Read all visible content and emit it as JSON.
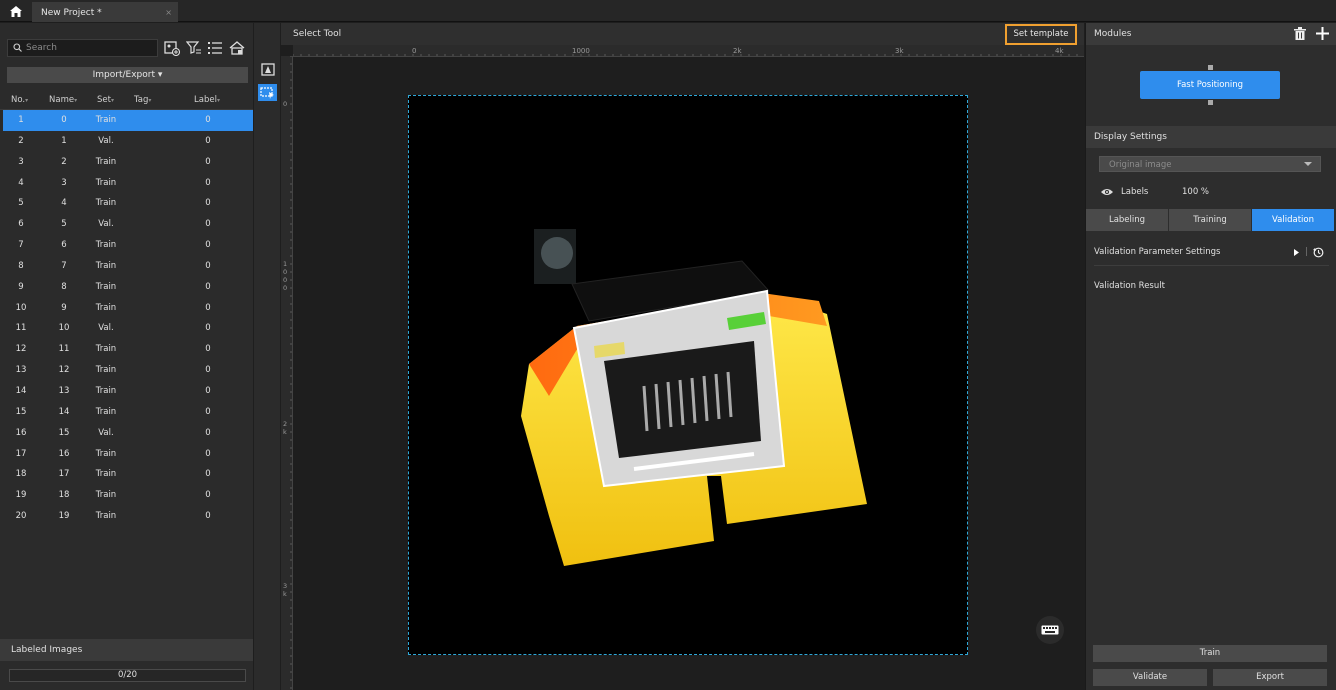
{
  "titlebar": {
    "tab_title": "New Project *",
    "tab_close": "×"
  },
  "left_panel": {
    "search_placeholder": "Search",
    "import_export": "Import/Export",
    "columns": [
      "No.",
      "Name",
      "Set",
      "Tag",
      "Label"
    ],
    "rows": [
      {
        "no": "1",
        "name": "0",
        "set": "Train",
        "label": "0"
      },
      {
        "no": "2",
        "name": "1",
        "set": "Val.",
        "label": "0"
      },
      {
        "no": "3",
        "name": "2",
        "set": "Train",
        "label": "0"
      },
      {
        "no": "4",
        "name": "3",
        "set": "Train",
        "label": "0"
      },
      {
        "no": "5",
        "name": "4",
        "set": "Train",
        "label": "0"
      },
      {
        "no": "6",
        "name": "5",
        "set": "Val.",
        "label": "0"
      },
      {
        "no": "7",
        "name": "6",
        "set": "Train",
        "label": "0"
      },
      {
        "no": "8",
        "name": "7",
        "set": "Train",
        "label": "0"
      },
      {
        "no": "9",
        "name": "8",
        "set": "Train",
        "label": "0"
      },
      {
        "no": "10",
        "name": "9",
        "set": "Train",
        "label": "0"
      },
      {
        "no": "11",
        "name": "10",
        "set": "Val.",
        "label": "0"
      },
      {
        "no": "12",
        "name": "11",
        "set": "Train",
        "label": "0"
      },
      {
        "no": "13",
        "name": "12",
        "set": "Train",
        "label": "0"
      },
      {
        "no": "14",
        "name": "13",
        "set": "Train",
        "label": "0"
      },
      {
        "no": "15",
        "name": "14",
        "set": "Train",
        "label": "0"
      },
      {
        "no": "16",
        "name": "15",
        "set": "Val.",
        "label": "0"
      },
      {
        "no": "17",
        "name": "16",
        "set": "Train",
        "label": "0"
      },
      {
        "no": "18",
        "name": "17",
        "set": "Train",
        "label": "0"
      },
      {
        "no": "19",
        "name": "18",
        "set": "Train",
        "label": "0"
      },
      {
        "no": "20",
        "name": "19",
        "set": "Train",
        "label": "0"
      }
    ],
    "selected_row": 0,
    "labeled_images_title": "Labeled Images",
    "labeled_progress": "0/20"
  },
  "canvas": {
    "tool_title": "Select Tool",
    "set_template": "Set template",
    "h_ruler_labels": [
      "0",
      "1000",
      "2k",
      "3k",
      "4k"
    ],
    "v_ruler_labels": [
      "0",
      "1\n0\n0\n0",
      "2\nk",
      "3\nk"
    ]
  },
  "right_panel": {
    "modules_title": "Modules",
    "module_node": "Fast Positioning",
    "display_settings_title": "Display Settings",
    "display_dropdown": "Original image",
    "labels_text": "Labels",
    "labels_percent": "100 %",
    "tabs": [
      "Labeling",
      "Training",
      "Validation"
    ],
    "active_tab": "Validation",
    "validation_param_settings": "Validation Parameter Settings",
    "validation_result": "Validation Result",
    "train_button": "Train",
    "validate_button": "Validate",
    "export_button": "Export"
  },
  "colors": {
    "accent": "#2f8ded",
    "highlight_border": "#f0a030",
    "bbox": "#2fa8d8"
  }
}
